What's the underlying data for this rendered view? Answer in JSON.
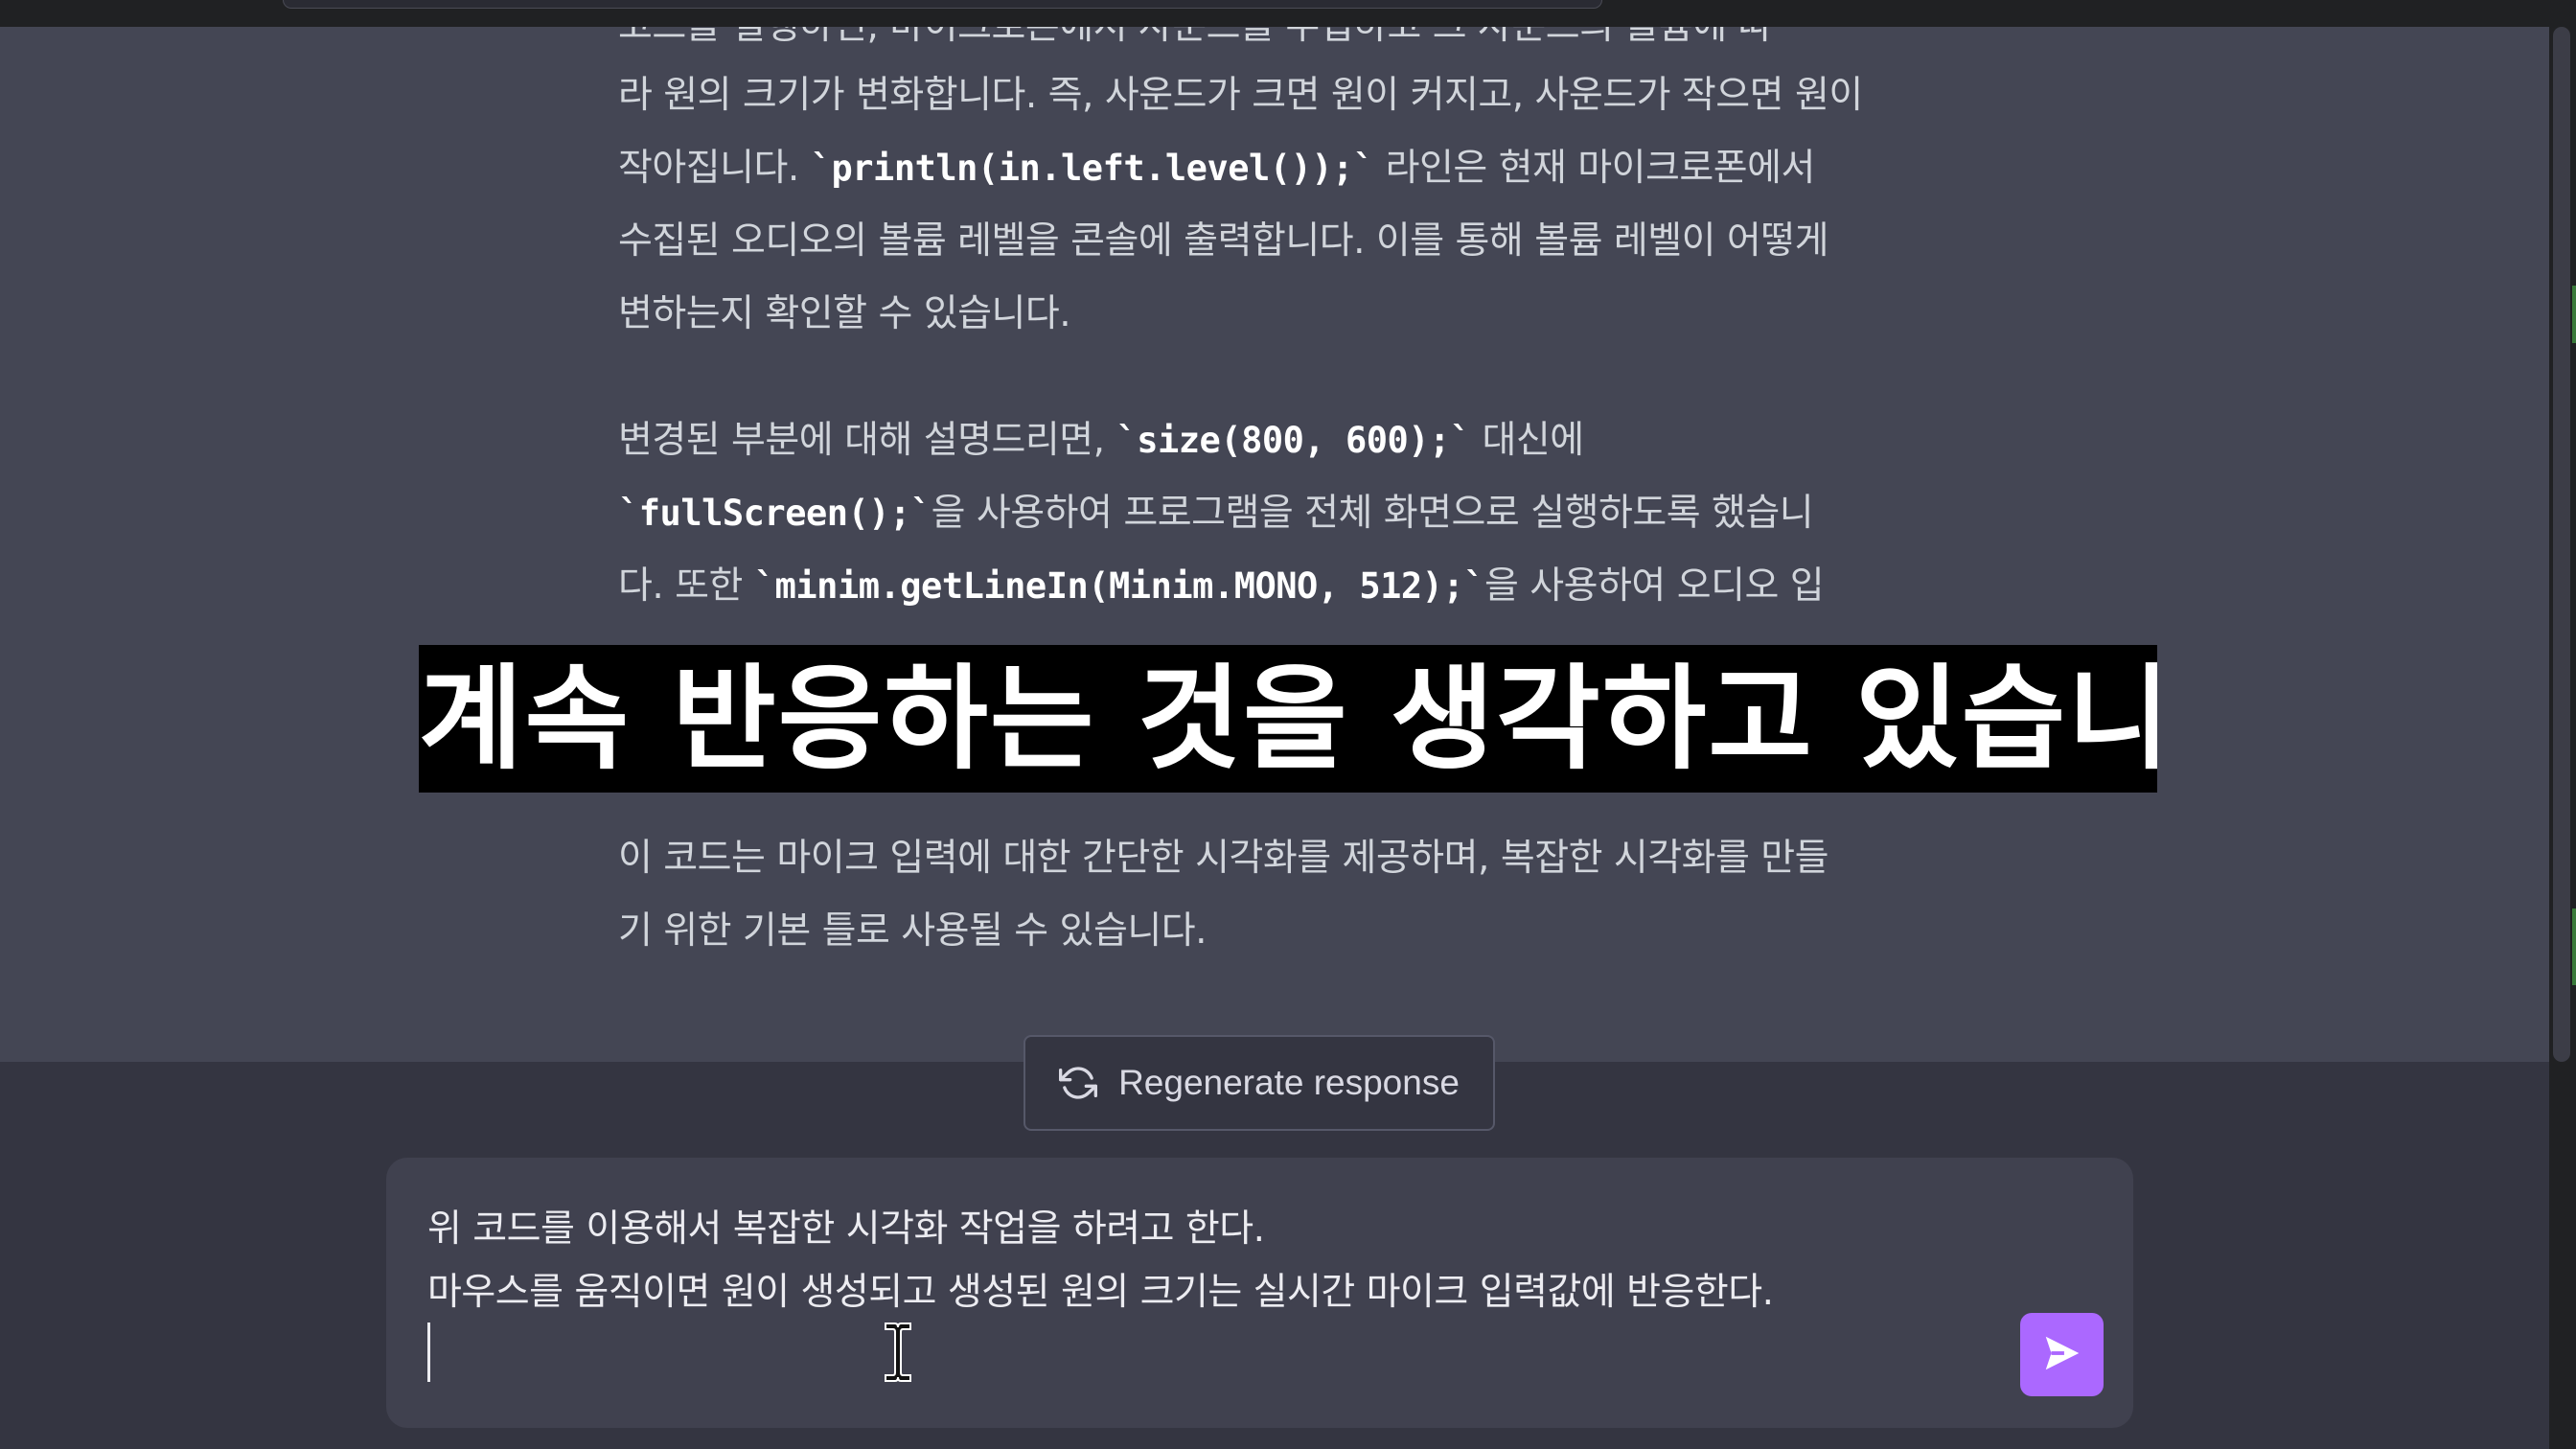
{
  "chat": {
    "partial_top_line": "코드를 실행하면, 마이크로폰에서 사운드를 수집하고 그 사운드의 볼륨에 따",
    "para1": [
      "라 원의 크기가 변화합니다. 즉, 사운드가 크면 원이 커지고, 사운드가 작으면 원이",
      "작아집니다.",
      "`println(in.left.level());`",
      "라인은 현재 마이크로폰에서",
      "수집된 오디오의 볼륨 레벨을 콘솔에 출력합니다. 이를 통해 볼륨 레벨이 어떻게",
      "변하는지 확인할 수 있습니다."
    ],
    "para2": [
      "변경된 부분에 대해 설명드리면,",
      "`size(800, 600);`",
      "대신에",
      "`fullScreen();`",
      "을 사용하여 프로그램을 전체 화면으로 실행하도록 했습니",
      "다. 또한",
      "`minim.getLineIn(Minim.MONO, 512);`",
      "을 사용하여 오디오 입"
    ],
    "para3": [
      "이 코드는 마이크 입력에 대한 간단한 시각화를 제공하며, 복잡한 시각화를 만들",
      "기 위한 기본 틀로 사용될 수 있습니다."
    ]
  },
  "subtitle": "계속 반응하는 것을 생각하고 있습니다",
  "regenerate": {
    "label": "Regenerate response",
    "icon": "refresh-icon"
  },
  "composer": {
    "lines": [
      "위 코드를 이용해서 복잡한 시각화 작업을 하려고 한다.",
      "마우스를 움직이면 원이 생성되고 생성된 원의 크기는 실시간 마이크 입력값에 반응한다."
    ],
    "send_icon": "send-icon",
    "send_color": "#ab68ff"
  },
  "colors": {
    "chat_bg": "#444654",
    "page_bg": "#343541",
    "composer_bg": "#40414f"
  }
}
